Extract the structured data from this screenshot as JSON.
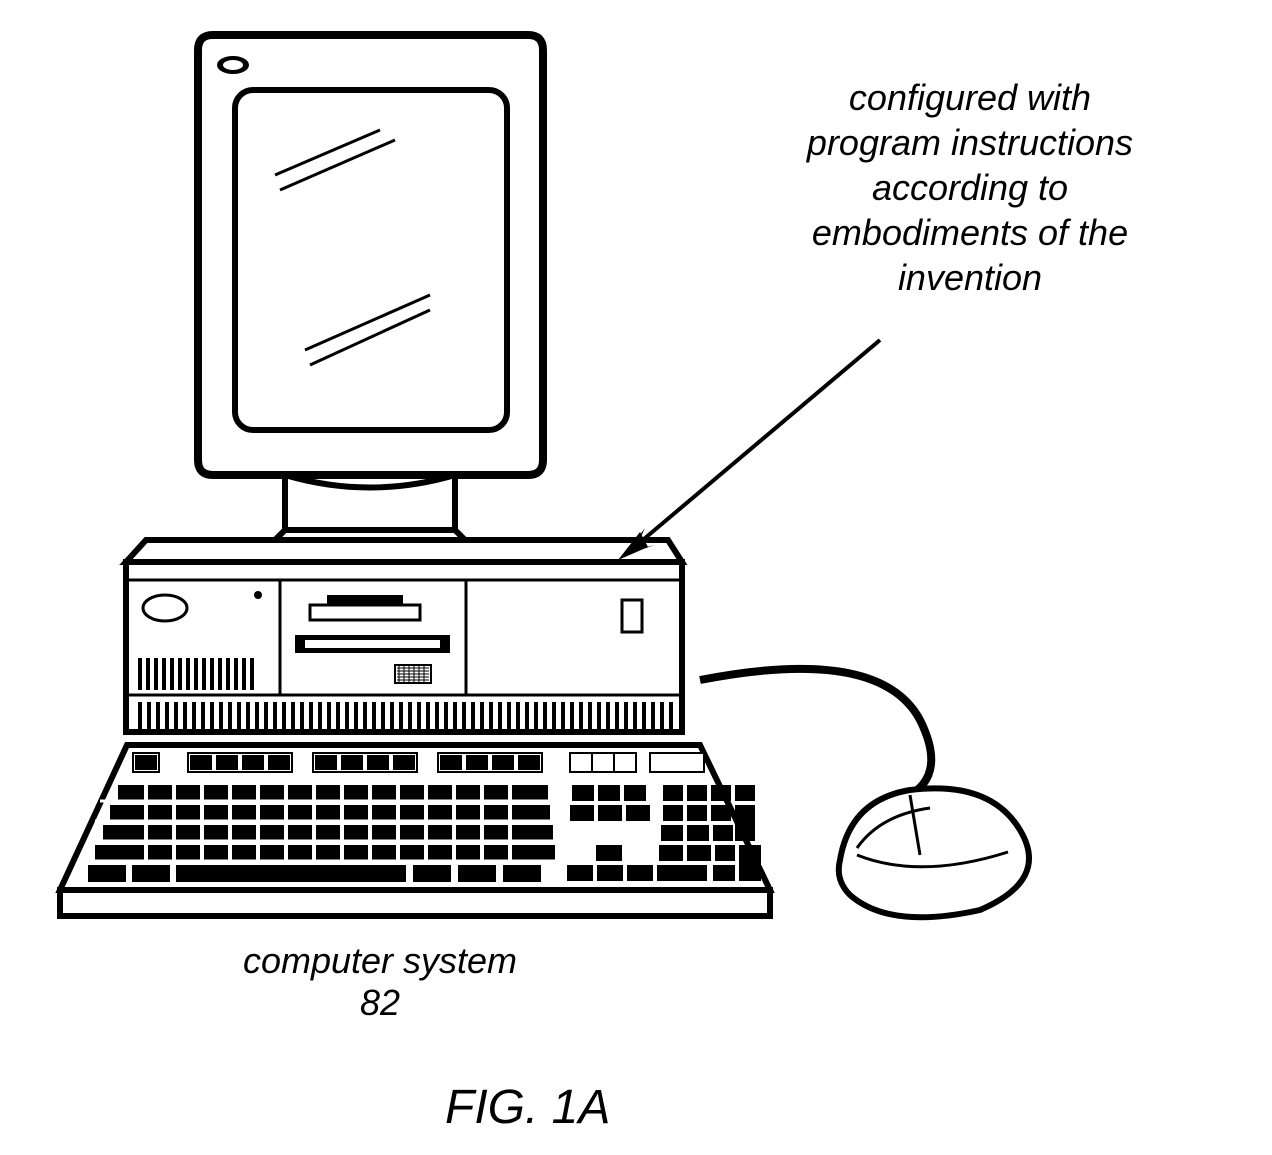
{
  "annotation": {
    "line1": "configured with",
    "line2": "program instructions",
    "line3": "according to",
    "line4": "embodiments of the",
    "line5": "invention"
  },
  "label": {
    "text": "computer system",
    "number": "82"
  },
  "figure": {
    "label": "FIG. 1A"
  }
}
